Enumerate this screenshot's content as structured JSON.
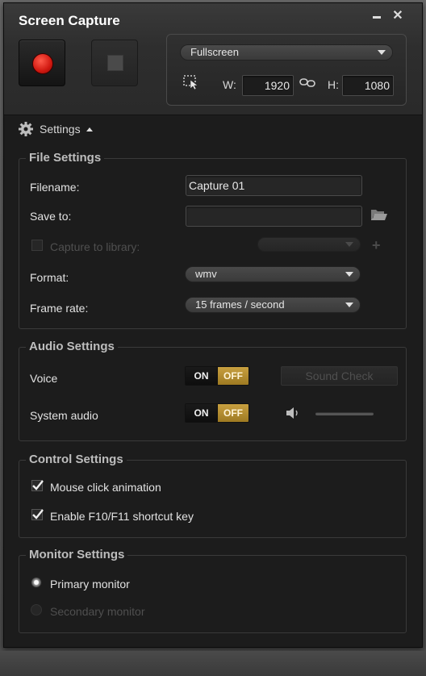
{
  "window": {
    "title": "Screen Capture"
  },
  "capture": {
    "mode": "Fullscreen",
    "width_label": "W:",
    "width_value": "1920",
    "height_label": "H:",
    "height_value": "1080"
  },
  "settings_toggle": {
    "label": "Settings"
  },
  "file_settings": {
    "title": "File Settings",
    "filename_label": "Filename:",
    "filename_value": "Capture 01",
    "save_to_label": "Save to:",
    "save_to_value": "",
    "capture_to_library_label": "Capture to library:",
    "format_label": "Format:",
    "format_value": "wmv",
    "frame_rate_label": "Frame rate:",
    "frame_rate_value": "15 frames / second"
  },
  "audio_settings": {
    "title": "Audio Settings",
    "voice_label": "Voice",
    "system_audio_label": "System audio",
    "on_label": "ON",
    "off_label": "OFF",
    "sound_check_label": "Sound Check"
  },
  "control_settings": {
    "title": "Control Settings",
    "mouse_click_label": "Mouse click animation",
    "shortcut_label": "Enable F10/F11 shortcut key"
  },
  "monitor_settings": {
    "title": "Monitor Settings",
    "primary_label": "Primary monitor",
    "secondary_label": "Secondary monitor"
  },
  "colors": {
    "background": "#1c1c1c",
    "record_red": "#d01810",
    "toggle_off_gold": "#c8a040"
  }
}
